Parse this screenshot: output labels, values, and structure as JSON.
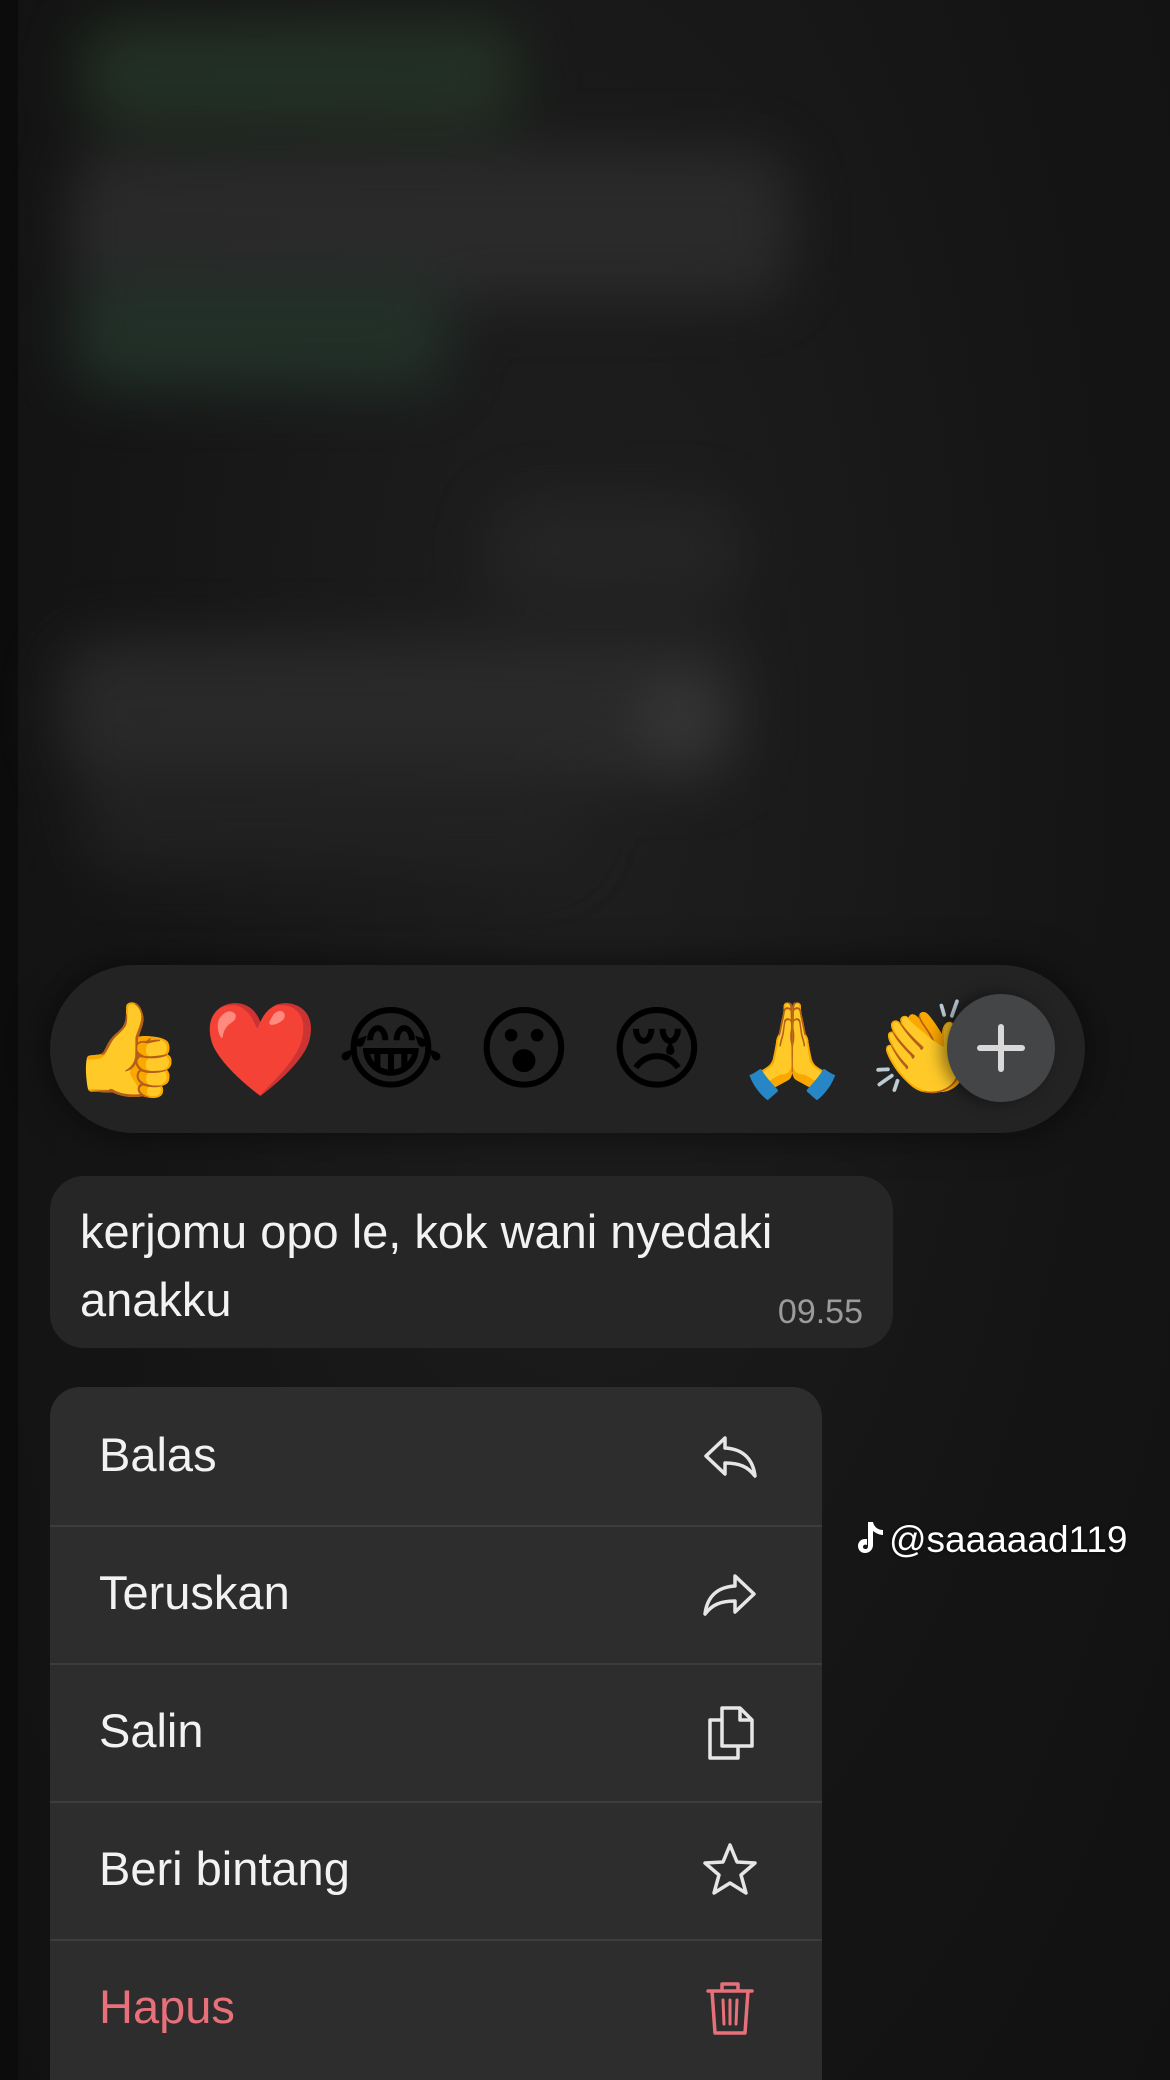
{
  "reactions": [
    {
      "emoji": "👍",
      "name": "thumbs-up"
    },
    {
      "emoji": "❤️",
      "name": "red-heart"
    },
    {
      "emoji": "😂",
      "name": "tears-of-joy"
    },
    {
      "emoji": "😮",
      "name": "surprised"
    },
    {
      "emoji": "😢",
      "name": "crying"
    },
    {
      "emoji": "🙏",
      "name": "folded-hands"
    },
    {
      "emoji": "👏",
      "name": "clapping-hands"
    }
  ],
  "more_reactions_icon": "plus-icon",
  "message": {
    "text": "kerjomu opo le, kok wani nyedaki anakku",
    "time": "09.55"
  },
  "menu": {
    "reply": {
      "label": "Balas",
      "icon": "reply-icon"
    },
    "forward": {
      "label": "Teruskan",
      "icon": "forward-icon"
    },
    "copy": {
      "label": "Salin",
      "icon": "copy-icon"
    },
    "star": {
      "label": "Beri bintang",
      "icon": "star-icon"
    },
    "delete": {
      "label": "Hapus",
      "icon": "trash-icon"
    }
  },
  "watermark": {
    "handle": "@saaaaad119",
    "icon": "tiktok-logo"
  },
  "colors": {
    "background": "#141414",
    "menu_background": "#2d2d2d",
    "danger": "#e8707a",
    "text": "#f2f2f2"
  }
}
